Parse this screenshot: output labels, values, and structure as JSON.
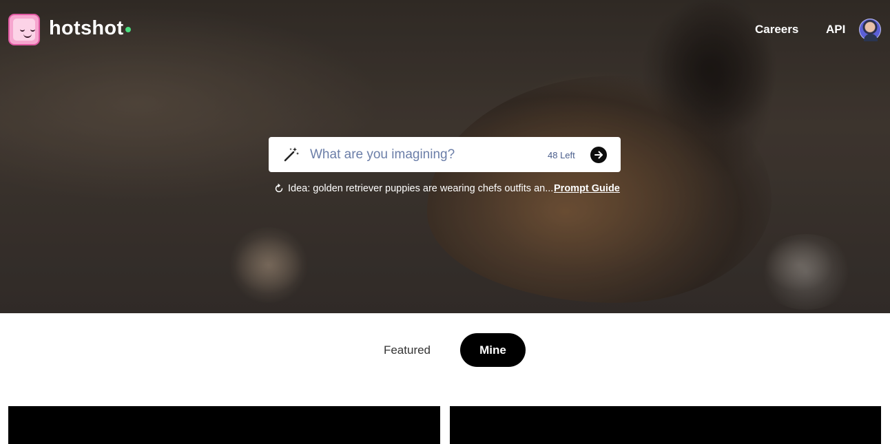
{
  "header": {
    "brand": "hotshot",
    "nav": [
      {
        "label": "Careers"
      },
      {
        "label": "API"
      }
    ],
    "status_color": "#4ade80"
  },
  "search": {
    "placeholder": "What are you imagining?",
    "value": "",
    "remaining": "48 Left",
    "icon": "magic-wand-icon",
    "submit_icon": "arrow-right-icon"
  },
  "idea": {
    "text": "Idea: golden retriever puppies are wearing chefs outfits an...",
    "link": "Prompt Guide",
    "icon": "refresh-icon"
  },
  "tabs": [
    {
      "label": "Featured",
      "active": false
    },
    {
      "label": "Mine",
      "active": true
    }
  ],
  "colors": {
    "accent": "#000000",
    "logo_pink": "#f6a6cf"
  }
}
